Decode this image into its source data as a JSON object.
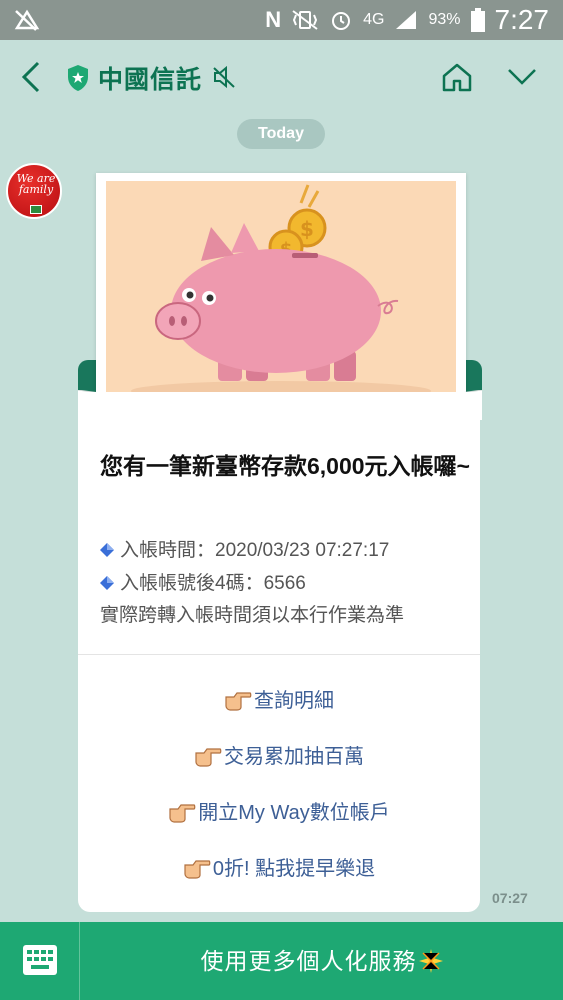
{
  "status_bar": {
    "battery": "93%",
    "network": "4G",
    "time": "7:27"
  },
  "header": {
    "title": "中國信託"
  },
  "date_chip": "Today",
  "avatar_text": "We are family",
  "message": {
    "title": "您有一筆新臺幣存款6,000元入帳囉~",
    "lines": [
      "入帳時間：2020/03/23 07:27:17",
      "入帳帳號後4碼：6566",
      "實際跨轉入帳時間須以本行作業為準"
    ],
    "links": [
      "查詢明細",
      "交易累加抽百萬",
      "開立My Way數位帳戶",
      "0折! 點我提早樂退"
    ],
    "time": "07:27"
  },
  "bottom_bar": {
    "label": "使用更多個人化服務"
  },
  "colors": {
    "brand_green": "#0d7352",
    "bar_green": "#1ea873",
    "chat_bg": "#c5dfd9",
    "link_blue": "#3d5f96"
  },
  "icons": [
    "back-icon",
    "shield-icon",
    "mute-icon",
    "home-icon",
    "chevron-down-icon",
    "diamond-icon",
    "pointing-hand-icon",
    "keyboard-icon",
    "sparkle-icon"
  ]
}
